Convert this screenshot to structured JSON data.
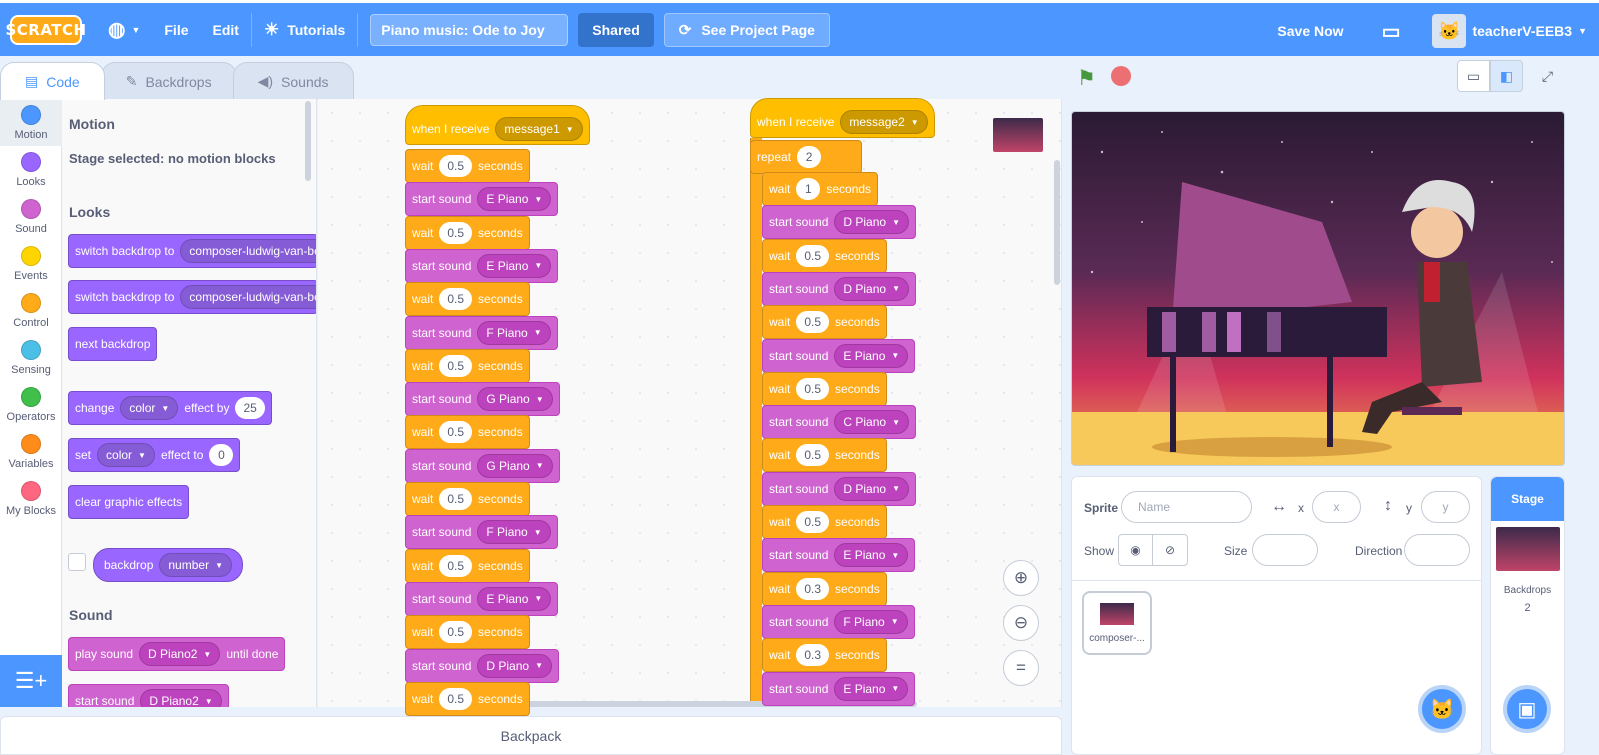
{
  "menu": {
    "logo": "SCRATCH",
    "file": "File",
    "edit": "Edit",
    "tutorials": "Tutorials",
    "project_title": "Piano music: Ode to Joy",
    "shared": "Shared",
    "see_project": "See Project Page",
    "save_now": "Save Now",
    "username": "teacherV-EEB3",
    "accent": "#4c97ff"
  },
  "tabs": {
    "code": "Code",
    "backdrops": "Backdrops",
    "sounds": "Sounds"
  },
  "categories": [
    {
      "label": "Motion",
      "color": "#4c97ff"
    },
    {
      "label": "Looks",
      "color": "#9966ff"
    },
    {
      "label": "Sound",
      "color": "#cf63cf"
    },
    {
      "label": "Events",
      "color": "#ffd500"
    },
    {
      "label": "Control",
      "color": "#ffab19"
    },
    {
      "label": "Sensing",
      "color": "#4cbfe6"
    },
    {
      "label": "Operators",
      "color": "#40bf4a"
    },
    {
      "label": "Variables",
      "color": "#ff8c1a"
    },
    {
      "label": "My Blocks",
      "color": "#ff6680"
    }
  ],
  "palette": {
    "motion_head": "Motion",
    "motion_note": "Stage selected: no motion blocks",
    "looks_head": "Looks",
    "switch_backdrop": "switch backdrop to",
    "backdrop_value": "composer-ludwig-van-beeth",
    "next_backdrop": "next backdrop",
    "change": "change",
    "color": "color",
    "effect_by": "effect by",
    "change_val": "25",
    "set": "set",
    "effect_to": "effect to",
    "set_val": "0",
    "clear_effects": "clear graphic effects",
    "backdrop": "backdrop",
    "number": "number",
    "sound_head": "Sound",
    "play_sound": "play sound",
    "until_done": "until done",
    "start_sound": "start sound",
    "piano2": "D Piano2"
  },
  "script1": {
    "hat": "when I receive",
    "message": "message1",
    "wait": "wait",
    "seconds": "seconds",
    "start_sound": "start sound",
    "steps": [
      [
        "0.5",
        "E Piano"
      ],
      [
        "0.5",
        "E Piano"
      ],
      [
        "0.5",
        "F Piano"
      ],
      [
        "0.5",
        "G Piano"
      ],
      [
        "0.5",
        "G Piano"
      ],
      [
        "0.5",
        "F Piano"
      ],
      [
        "0.5",
        "E Piano"
      ],
      [
        "0.5",
        "D Piano"
      ],
      [
        "0.5",
        ""
      ]
    ]
  },
  "script2": {
    "hat": "when I receive",
    "message": "message2",
    "repeat": "repeat",
    "repeat_val": "2",
    "wait": "wait",
    "seconds": "seconds",
    "start_sound": "start sound",
    "steps": [
      [
        "1",
        "D Piano"
      ],
      [
        "0.5",
        "D Piano"
      ],
      [
        "0.5",
        "E Piano"
      ],
      [
        "0.5",
        "C Piano"
      ],
      [
        "0.5",
        "D Piano"
      ],
      [
        "0.5",
        "E Piano"
      ],
      [
        "0.3",
        "F Piano"
      ],
      [
        "0.3",
        "E Piano"
      ]
    ]
  },
  "backpack": "Backpack",
  "sprite_info": {
    "sprite": "Sprite",
    "name_ph": "Name",
    "x": "x",
    "y": "y",
    "x_ph": "x",
    "y_ph": "y",
    "show": "Show",
    "size": "Size",
    "direction": "Direction"
  },
  "sprite_list": [
    {
      "name": "composer-..."
    }
  ],
  "stage_panel": {
    "title": "Stage",
    "backdrops": "Backdrops",
    "count": "2"
  }
}
